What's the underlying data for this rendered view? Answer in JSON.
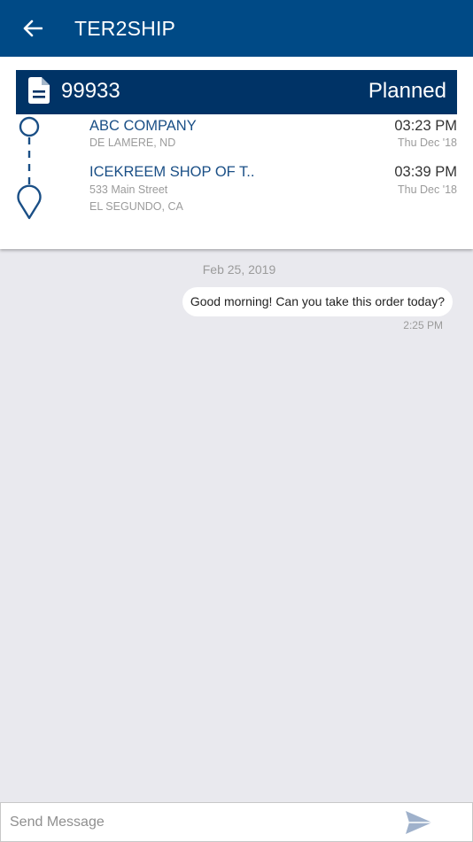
{
  "header": {
    "title": "TER2SHIP",
    "back_icon": "arrow-left-icon",
    "bg_color": "#004a86"
  },
  "order": {
    "number": "99933",
    "status": "Planned",
    "doc_icon": "document-icon",
    "header_color": "#003366"
  },
  "stops": [
    {
      "name": "ABC COMPANY",
      "address_lines": [
        "DE LAMERE, ND"
      ],
      "time": "03:23 PM",
      "date": "Thu Dec '18",
      "marker_icon": "origin-circle-icon"
    },
    {
      "name": "ICEKREEM SHOP OF T..",
      "address_lines": [
        "533 Main Street",
        "EL SEGUNDO, CA"
      ],
      "time": "03:39 PM",
      "date": "Thu Dec '18",
      "marker_icon": "destination-pin-icon"
    }
  ],
  "chat": {
    "date_label": "Feb 25, 2019",
    "messages": [
      {
        "text": "Good morning! Can you take this order today?",
        "time": "2:25 PM"
      }
    ]
  },
  "composer": {
    "placeholder": "Send Message",
    "value": "",
    "send_icon": "send-icon"
  }
}
